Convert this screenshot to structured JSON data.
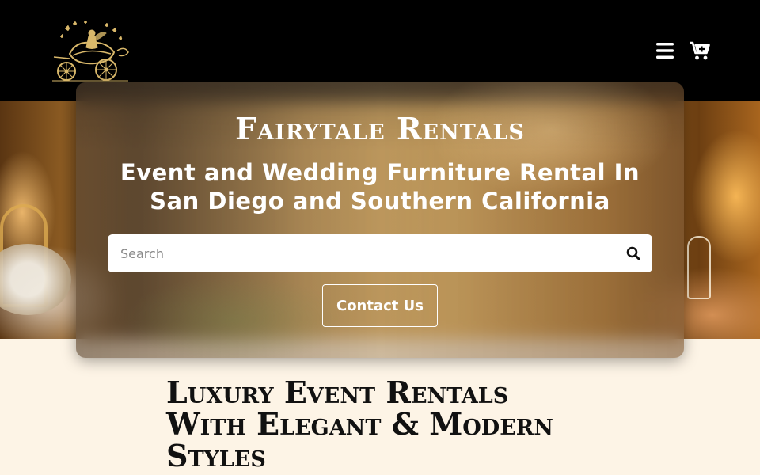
{
  "header": {
    "logo_icon": "carriage-fairy-logo-icon",
    "menu_icon": "hamburger-menu-icon",
    "cart_icon": "cart-plus-icon"
  },
  "hero": {
    "brand_title": "Fairytale Rentals",
    "subtitle": "Event and Wedding Furniture Rental In San Diego and Southern California",
    "search": {
      "placeholder": "Search",
      "value": "",
      "icon": "search-icon"
    },
    "contact_label": "Contact Us"
  },
  "section": {
    "heading": "Luxury Event Rentals With Elegant & Modern Styles"
  },
  "colors": {
    "header_bg": "#000000",
    "page_bg": "#fdf4e6",
    "logo_gold": "#d9b86a",
    "text_light": "#ffffff",
    "heading_dark": "#111111"
  }
}
